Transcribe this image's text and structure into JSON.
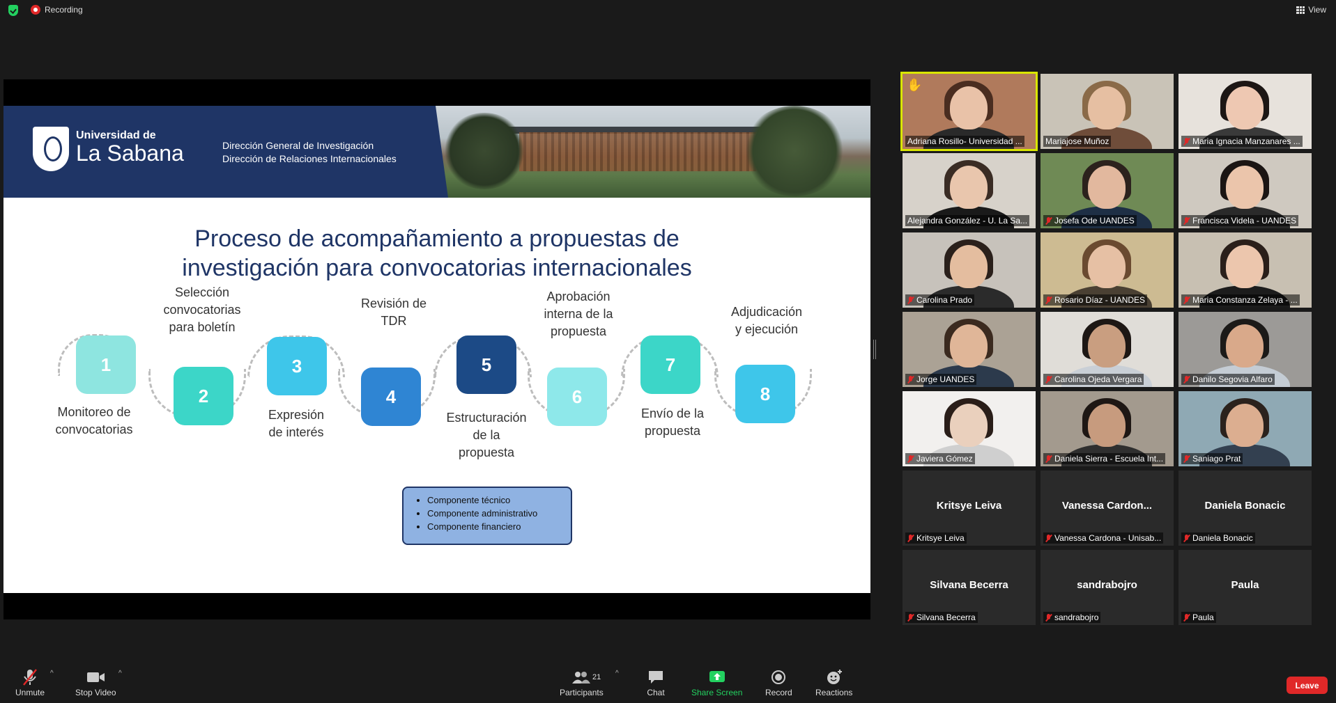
{
  "topbar": {
    "recording": "Recording",
    "view": "View"
  },
  "slide": {
    "university_small": "Universidad de",
    "university_big": "La Sabana",
    "dir1": "Dirección General de Investigación",
    "dir2": "Dirección de Relaciones Internacionales",
    "title_line1": "Proceso de acompañamiento a propuestas de",
    "title_line2": "investigación para convocatorias internacionales",
    "steps": [
      {
        "num": "1",
        "label": "Monitoreo de\nconvocatorias"
      },
      {
        "num": "2",
        "label": "Selección\nconvocatorias\npara boletín"
      },
      {
        "num": "3",
        "label": "Expresión\nde interés"
      },
      {
        "num": "4",
        "label": "Revisión de\nTDR"
      },
      {
        "num": "5",
        "label": "Estructuración\nde la\npropuesta"
      },
      {
        "num": "6",
        "label": "Aprobación\ninterna de la\npropuesta"
      },
      {
        "num": "7",
        "label": "Envío de la\npropuesta"
      },
      {
        "num": "8",
        "label": "Adjudicación\ny ejecución"
      }
    ],
    "components": [
      "Componente técnico",
      "Componente administrativo",
      "Componente financiero"
    ]
  },
  "participants": [
    {
      "name": "Adriana Rosillo- Universidad ...",
      "muted": false
    },
    {
      "name": "Mariajose Muñoz",
      "muted": false
    },
    {
      "name": "Maria Ignacia Manzanares ...",
      "muted": true
    },
    {
      "name": "Alejandra González - U. La Sa...",
      "muted": false
    },
    {
      "name": "Josefa Ode UANDES",
      "muted": true
    },
    {
      "name": "Francisca Videla - UANDES",
      "muted": true
    },
    {
      "name": "Carolina Prado",
      "muted": true
    },
    {
      "name": "Rosario Díaz - UANDES",
      "muted": true
    },
    {
      "name": "Maria Constanza Zelaya - ...",
      "muted": true
    },
    {
      "name": "Jorge UANDES",
      "muted": true
    },
    {
      "name": "Carolina Ojeda Vergara",
      "muted": true
    },
    {
      "name": "Danilo Segovia Alfaro",
      "muted": true
    },
    {
      "name": "Javiera Gómez",
      "muted": true
    },
    {
      "name": "Daniela Sierra - Escuela Int...",
      "muted": true
    },
    {
      "name": "Saniago Prat",
      "muted": true
    },
    {
      "name": "Kritsye Leiva",
      "muted": true,
      "display": "Kritsye Leiva"
    },
    {
      "name": "Vanessa Cardona - Unisab...",
      "muted": true,
      "display": "Vanessa  Cardon..."
    },
    {
      "name": "Daniela Bonacic",
      "muted": true,
      "display": "Daniela Bonacic"
    },
    {
      "name": "Silvana Becerra",
      "muted": true,
      "display": "Silvana Becerra"
    },
    {
      "name": "sandrabojro",
      "muted": true,
      "display": "sandrabojro"
    },
    {
      "name": "Paula",
      "muted": true,
      "display": "Paula"
    }
  ],
  "toolbar": {
    "unmute": "Unmute",
    "stop_video": "Stop Video",
    "participants": "Participants",
    "participants_count": "21",
    "chat": "Chat",
    "share_screen": "Share Screen",
    "record": "Record",
    "reactions": "Reactions",
    "leave": "Leave"
  }
}
